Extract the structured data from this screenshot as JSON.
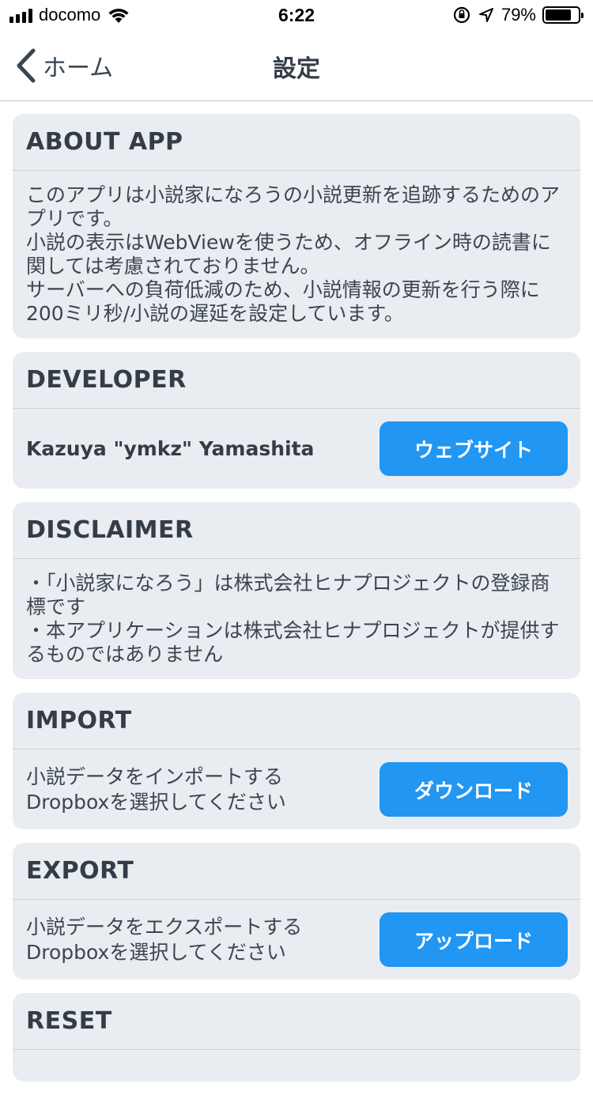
{
  "status_bar": {
    "carrier": "docomo",
    "time": "6:22",
    "battery_percent": "79%",
    "battery_level": 0.79,
    "icons": [
      "signal-icon",
      "wifi-icon",
      "orientation-lock-icon",
      "location-icon",
      "battery-icon"
    ]
  },
  "nav": {
    "back_label": "ホーム",
    "title": "設定"
  },
  "about": {
    "heading": "ABOUT APP",
    "paragraphs": [
      "このアプリは小説家になろうの小説更新を追跡するためのアプリです。",
      "小説の表示はWebViewを使うため、オフライン時の読書に関しては考慮されておりません。",
      "サーバーへの負荷低減のため、小説情報の更新を行う際に200ミリ秒/小説の遅延を設定しています。"
    ]
  },
  "developer": {
    "heading": "DEVELOPER",
    "name": "Kazuya \"ymkz\" Yamashita",
    "button": "ウェブサイト"
  },
  "disclaimer": {
    "heading": "DISCLAIMER",
    "paragraphs": [
      "・「小説家になろう」は株式会社ヒナプロジェクトの登録商標です",
      "・本アプリケーションは株式会社ヒナプロジェクトが提供するものではありません"
    ]
  },
  "import": {
    "heading": "IMPORT",
    "line1": "小説データをインポートする",
    "line2": "Dropboxを選択してください",
    "button": "ダウンロード"
  },
  "export": {
    "heading": "EXPORT",
    "line1": "小説データをエクスポートする",
    "line2": "Dropboxを選択してください",
    "button": "アップロード"
  },
  "reset": {
    "heading": "RESET"
  },
  "colors": {
    "accent": "#2196f3",
    "card_bg": "#e9ecf0",
    "text": "#333d47"
  }
}
